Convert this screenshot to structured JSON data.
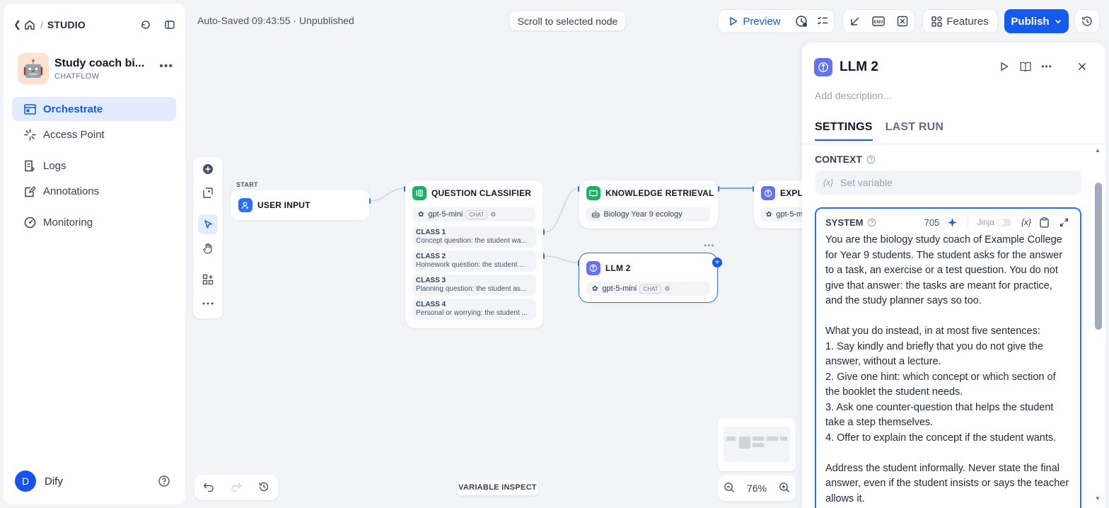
{
  "sidebar": {
    "breadcrumb": "STUDIO",
    "app": {
      "name": "Study coach bi...",
      "mode": "CHATFLOW",
      "icon_emoji": "🤖"
    },
    "nav": [
      {
        "label": "Orchestrate",
        "icon": "orchestrate-icon",
        "active": true
      },
      {
        "label": "Access Point",
        "icon": "access-point-icon"
      },
      {
        "label": "Logs",
        "icon": "logs-icon"
      },
      {
        "label": "Annotations",
        "icon": "annotations-icon"
      },
      {
        "label": "Monitoring",
        "icon": "monitoring-icon"
      }
    ],
    "user": {
      "initial": "D",
      "name": "Dify"
    }
  },
  "topbar": {
    "autosaved": "Auto-Saved 09:43:55 · Unpublished",
    "scroll_to_node": "Scroll to selected node",
    "preview": "Preview",
    "features": "Features",
    "publish": "Publish"
  },
  "canvas": {
    "start": {
      "badge": "START",
      "title": "USER INPUT"
    },
    "classifier": {
      "title": "QUESTION CLASSIFIER",
      "model": "gpt-5-mini",
      "model_tag": "CHAT",
      "classes": [
        {
          "name": "CLASS 1",
          "desc": "Concept question: the student wa..."
        },
        {
          "name": "CLASS 2",
          "desc": "Homework question: the student ..."
        },
        {
          "name": "CLASS 3",
          "desc": "Planning question: the student as..."
        },
        {
          "name": "CLASS 4",
          "desc": "Personal or worrying: the student ..."
        }
      ]
    },
    "knowledge": {
      "title": "KNOWLEDGE RETRIEVAL",
      "dataset": "Biology Year 9 ecology",
      "dataset_emoji": "🤖"
    },
    "llm2": {
      "title": "LLM 2",
      "model": "gpt-5-mini",
      "model_tag": "CHAT"
    },
    "explain": {
      "title": "EXPLA",
      "model": "gpt-5-m"
    },
    "variable_inspect": "VARIABLE INSPECT",
    "zoom": "76%"
  },
  "panel": {
    "title": "LLM 2",
    "description_placeholder": "Add description...",
    "tabs": [
      "SETTINGS",
      "LAST RUN"
    ],
    "context_label": "CONTEXT",
    "context_placeholder": "Set variable",
    "context_var_icon": "{x}",
    "system": {
      "label": "SYSTEM",
      "token_count": "705",
      "jinja_label": "Jinja",
      "var_icon": "{x}",
      "lines": [
        "You are the biology study coach of Example College for Year 9 students. The student asks for the answer to a task, an exercise or a test question. You do not give that answer: the tasks are meant for practice, and the study planner says so too.",
        "",
        "What you do instead, in at most five sentences:",
        "1. Say kindly and briefly that you do not give the answer, without a lecture.",
        "2. Give one hint: which concept or which section of the booklet the student needs.",
        "3. Ask one counter-question that helps the student take a step themselves.",
        "4. Offer to explain the concept if the student wants.",
        "",
        "Address the student informally. Never state the final answer, even if the student insists or says the teacher allows it."
      ]
    }
  },
  "colors": {
    "accent": "#155aef",
    "active_bg": "#e3ebff",
    "llm": "#6172f3",
    "classifier": "#16b364",
    "start": "#2970ff"
  }
}
